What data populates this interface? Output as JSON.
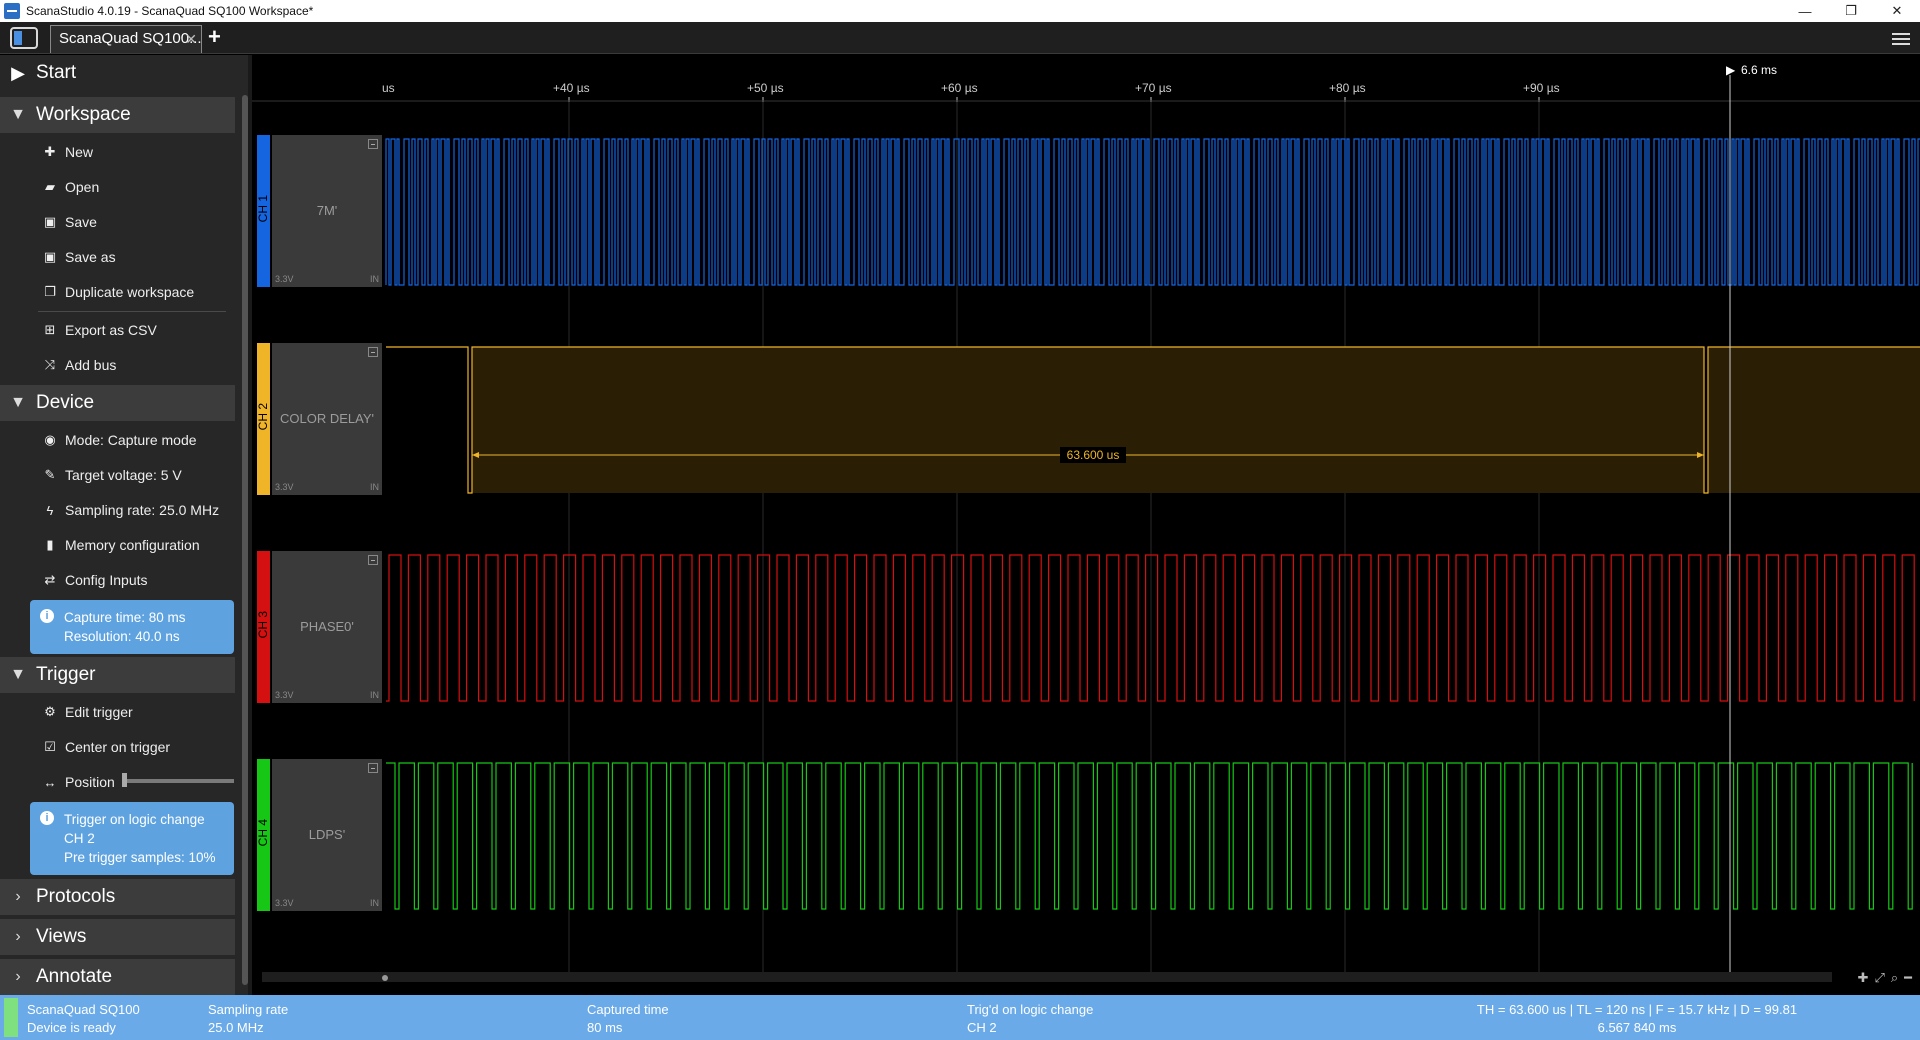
{
  "window": {
    "title": "ScanaStudio 4.0.19 - ScanaQuad SQ100 Workspace*",
    "controls": [
      "—",
      "❐",
      "✕"
    ]
  },
  "tabs": {
    "active_label": "ScanaQuad SQ100...",
    "close": "✕",
    "add": "+"
  },
  "sidebar": {
    "start": "Start",
    "workspace": {
      "title": "Workspace",
      "items": [
        "New",
        "Open",
        "Save",
        "Save as",
        "Duplicate workspace",
        "Export as CSV",
        "Add bus"
      ]
    },
    "device": {
      "title": "Device",
      "items": [
        "Mode: Capture mode",
        "Target voltage: 5 V",
        "Sampling rate: 25.0 MHz",
        "Memory configuration",
        "Config Inputs"
      ],
      "info": [
        "Capture time: 80 ms",
        "Resolution: 40.0 ns"
      ]
    },
    "trigger": {
      "title": "Trigger",
      "items": [
        "Edit trigger",
        "Center on trigger",
        "Position"
      ],
      "position_value": 0.0,
      "info": [
        "Trigger on logic change",
        "CH 2",
        "Pre trigger samples: 10%"
      ]
    },
    "protocols": "Protocols",
    "views": "Views",
    "annotate": "Annotate"
  },
  "ruler": {
    "ticks": [
      "us",
      "+40 µs",
      "+50 µs",
      "+60 µs",
      "+70 µs",
      "+80 µs",
      "+90 µs"
    ],
    "trigger_label": "6.6 ms"
  },
  "channels": [
    {
      "id": "CH 1",
      "name": "7M'",
      "voltage": "3.3V",
      "dir": "IN",
      "color": "#1565e0"
    },
    {
      "id": "CH 2",
      "name": "COLOR DELAY'",
      "voltage": "3.3V",
      "dir": "IN",
      "color": "#f0b429"
    },
    {
      "id": "CH 3",
      "name": "PHASE0'",
      "voltage": "3.3V",
      "dir": "IN",
      "color": "#d41010"
    },
    {
      "id": "CH 4",
      "name": "LDPS'",
      "voltage": "3.3V",
      "dir": "IN",
      "color": "#16c716"
    }
  ],
  "measurement": {
    "label": "63.600 us"
  },
  "statusbar": {
    "device_name": "ScanaQuad SQ100",
    "device_status": "Device is ready",
    "sampling_label": "Sampling rate",
    "sampling_value": "25.0 MHz",
    "captured_label": "Captured time",
    "captured_value": "80 ms",
    "trigger_label": "Trig'd on logic change",
    "trigger_value": "CH 2",
    "measure_line1": "TH = 63.600 us | TL = 120 ns | F = 15.7 kHz | D = 99.81",
    "measure_line2": "6.567 840 ms"
  }
}
